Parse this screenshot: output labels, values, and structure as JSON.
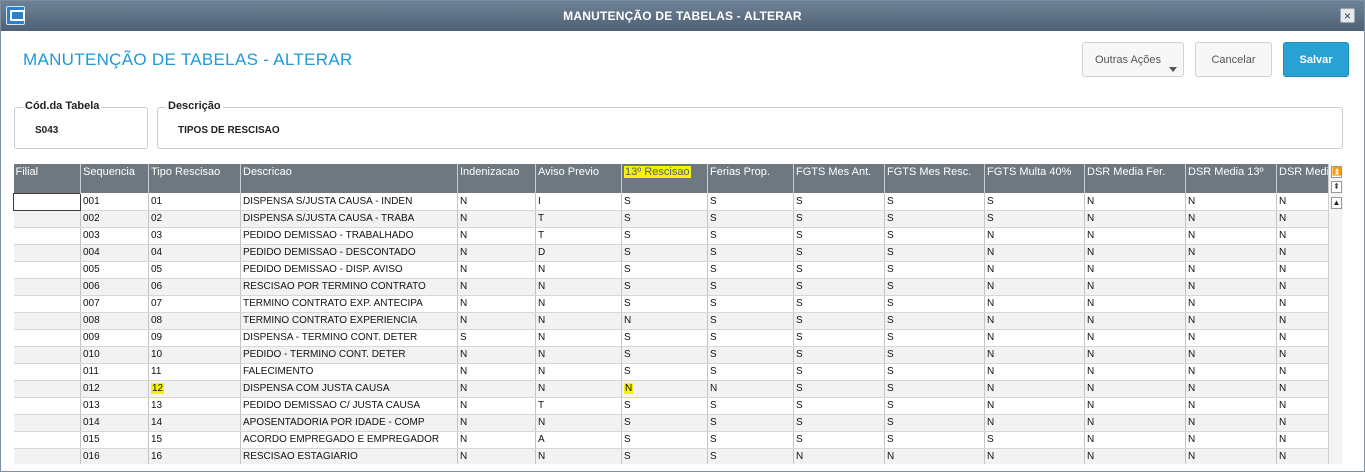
{
  "window": {
    "title": "MANUTENÇÃO DE TABELAS - ALTERAR",
    "close_glyph": "×"
  },
  "header": {
    "title": "MANUTENÇÃO DE TABELAS - ALTERAR",
    "outras_label": "Outras Ações",
    "cancelar_label": "Cancelar",
    "salvar_label": "Salvar"
  },
  "form": {
    "cod_label": "Cód.da Tabela",
    "cod_value": "S043",
    "desc_label": "Descrição",
    "desc_value": "TIPOS DE RESCISAO"
  },
  "grid": {
    "columns": [
      "Filial",
      "Sequencia",
      "Tipo Rescisao",
      "Descricao",
      "Indenizacao",
      "Aviso Previo",
      "13º Rescisao",
      "Ferias Prop.",
      "FGTS Mes Ant.",
      "FGTS Mes Resc.",
      "FGTS Multa 40%",
      "DSR Media Fer.",
      "DSR Media 13º",
      "DSR Media"
    ],
    "rows": [
      [
        "",
        "001",
        "01",
        "DISPENSA S/JUSTA CAUSA - INDEN",
        "N",
        "I",
        "S",
        "S",
        "S",
        "S",
        "S",
        "N",
        "N",
        "N"
      ],
      [
        "",
        "002",
        "02",
        "DISPENSA S/JUSTA CAUSA - TRABA",
        "N",
        "T",
        "S",
        "S",
        "S",
        "S",
        "S",
        "N",
        "N",
        "N"
      ],
      [
        "",
        "003",
        "03",
        "PEDIDO DEMISSAO - TRABALHADO",
        "N",
        "T",
        "S",
        "S",
        "S",
        "S",
        "N",
        "N",
        "N",
        "N"
      ],
      [
        "",
        "004",
        "04",
        "PEDIDO DEMISSAO - DESCONTADO",
        "N",
        "D",
        "S",
        "S",
        "S",
        "S",
        "N",
        "N",
        "N",
        "N"
      ],
      [
        "",
        "005",
        "05",
        "PEDIDO DEMISSAO - DISP. AVISO",
        "N",
        "N",
        "S",
        "S",
        "S",
        "S",
        "N",
        "N",
        "N",
        "N"
      ],
      [
        "",
        "006",
        "06",
        "RESCISAO POR TERMINO CONTRATO",
        "N",
        "N",
        "S",
        "S",
        "S",
        "S",
        "N",
        "N",
        "N",
        "N"
      ],
      [
        "",
        "007",
        "07",
        "TERMINO CONTRATO EXP. ANTECIPA",
        "N",
        "N",
        "S",
        "S",
        "S",
        "S",
        "N",
        "N",
        "N",
        "N"
      ],
      [
        "",
        "008",
        "08",
        "TERMINO CONTRATO EXPERIENCIA",
        "N",
        "N",
        "N",
        "S",
        "S",
        "S",
        "N",
        "N",
        "N",
        "N"
      ],
      [
        "",
        "009",
        "09",
        "DISPENSA - TERMINO CONT. DETER",
        "S",
        "N",
        "S",
        "S",
        "S",
        "S",
        "N",
        "N",
        "N",
        "N"
      ],
      [
        "",
        "010",
        "10",
        "PEDIDO - TERMINO CONT. DETER",
        "N",
        "N",
        "S",
        "S",
        "S",
        "S",
        "N",
        "N",
        "N",
        "N"
      ],
      [
        "",
        "011",
        "11",
        "FALECIMENTO",
        "N",
        "N",
        "S",
        "S",
        "S",
        "S",
        "N",
        "N",
        "N",
        "N"
      ],
      [
        "",
        "012",
        "12",
        "DISPENSA COM JUSTA CAUSA",
        "N",
        "N",
        "N",
        "N",
        "S",
        "S",
        "N",
        "N",
        "N",
        "N"
      ],
      [
        "",
        "013",
        "13",
        "PEDIDO DEMISSAO C/ JUSTA CAUSA",
        "N",
        "T",
        "S",
        "S",
        "S",
        "S",
        "N",
        "N",
        "N",
        "N"
      ],
      [
        "",
        "014",
        "14",
        "APOSENTADORIA POR IDADE - COMP",
        "N",
        "N",
        "S",
        "S",
        "S",
        "S",
        "N",
        "N",
        "N",
        "N"
      ],
      [
        "",
        "015",
        "15",
        "ACORDO EMPREGADO E EMPREGADOR",
        "N",
        "A",
        "S",
        "S",
        "S",
        "S",
        "S",
        "N",
        "N",
        "N"
      ],
      [
        "",
        "016",
        "16",
        "RESCISAO ESTAGIARIO",
        "N",
        "N",
        "S",
        "S",
        "N",
        "N",
        "N",
        "N",
        "N",
        "N"
      ]
    ],
    "highlight": {
      "header_col": 6,
      "cells": [
        [
          11,
          2
        ],
        [
          11,
          6
        ]
      ],
      "color": "#f6f200"
    }
  },
  "scrollbar": {
    "top_glyph": "⏫",
    "pageup_glyph": "⇞",
    "up_glyph": "▲"
  },
  "colors": {
    "title_blue": "#1e9ad6",
    "save_button": "#2aa1d3",
    "grid_header": "#6d7880",
    "title_bar": "#5e7184"
  }
}
